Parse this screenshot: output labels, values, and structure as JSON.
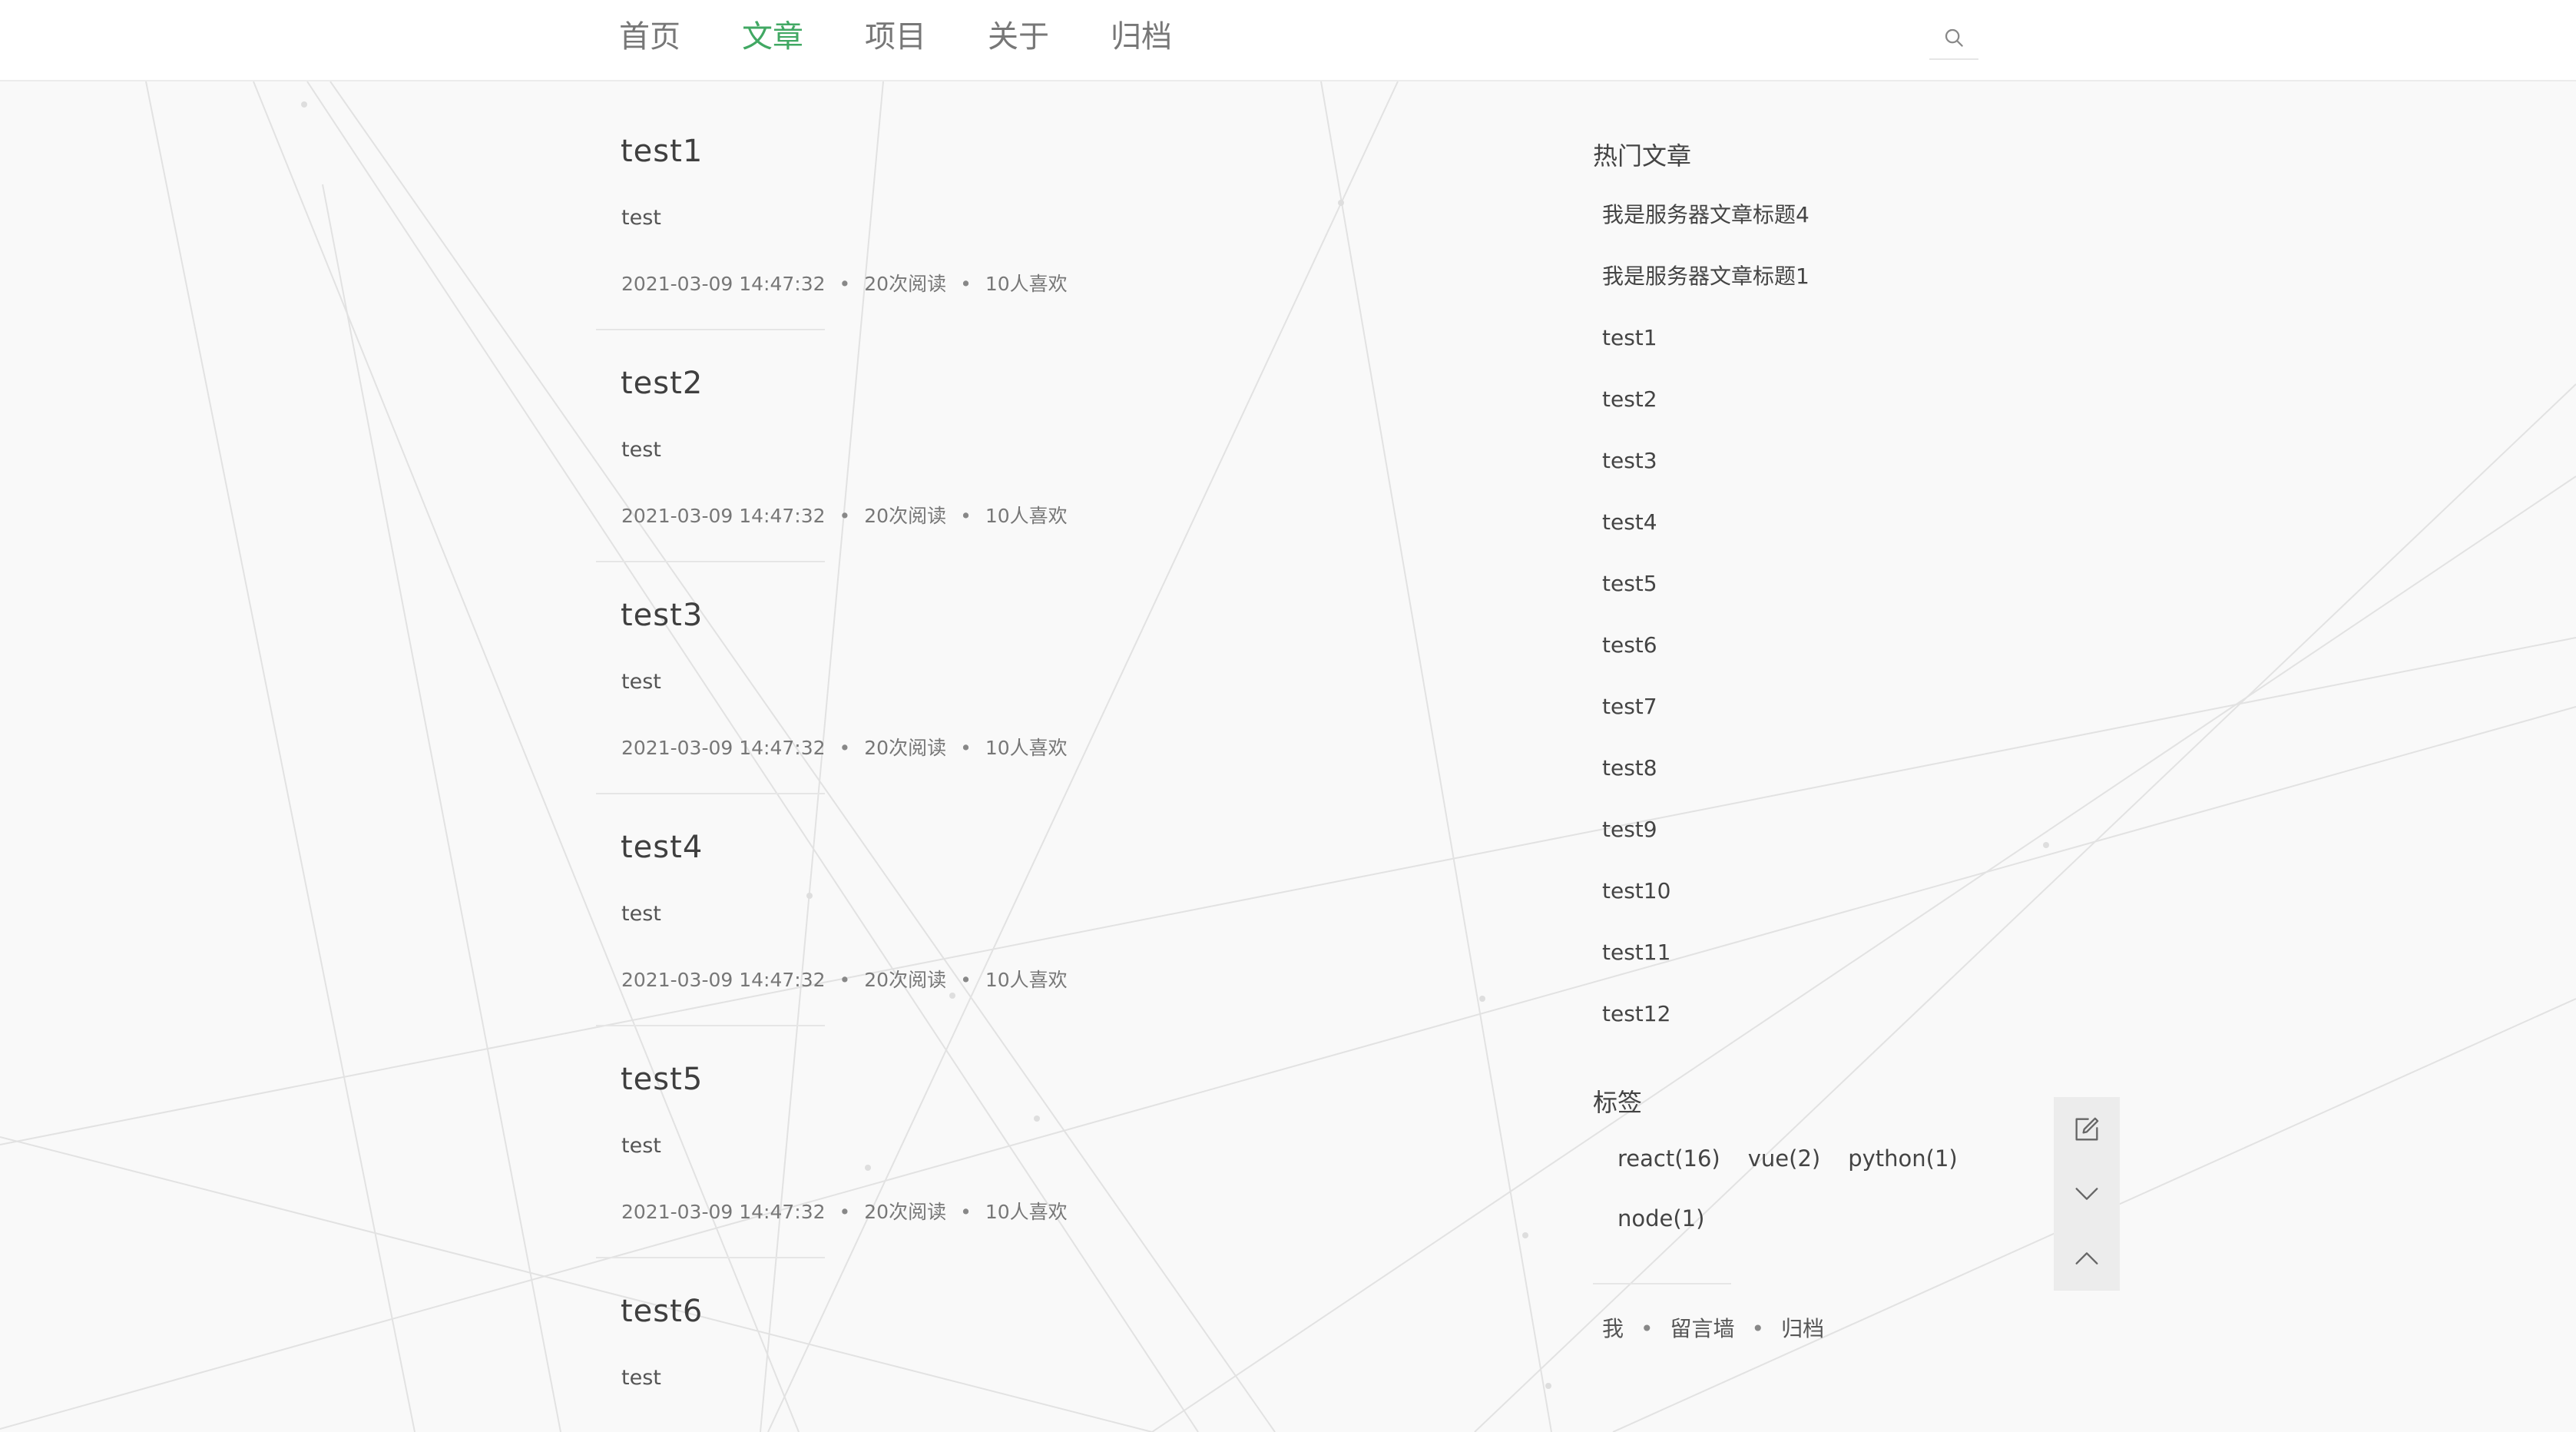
{
  "nav": {
    "items": [
      {
        "label": "首页"
      },
      {
        "label": "文章"
      },
      {
        "label": "项目"
      },
      {
        "label": "关于"
      },
      {
        "label": "归档"
      }
    ],
    "active_index": 1,
    "active_color": "#41a863",
    "search_icon": "search-icon"
  },
  "articles": [
    {
      "title": "test1",
      "summary": "test",
      "datetime": "2021-03-09 14:47:32",
      "reads": "20次阅读",
      "likes": "10人喜欢"
    },
    {
      "title": "test2",
      "summary": "test",
      "datetime": "2021-03-09 14:47:32",
      "reads": "20次阅读",
      "likes": "10人喜欢"
    },
    {
      "title": "test3",
      "summary": "test",
      "datetime": "2021-03-09 14:47:32",
      "reads": "20次阅读",
      "likes": "10人喜欢"
    },
    {
      "title": "test4",
      "summary": "test",
      "datetime": "2021-03-09 14:47:32",
      "reads": "20次阅读",
      "likes": "10人喜欢"
    },
    {
      "title": "test5",
      "summary": "test",
      "datetime": "2021-03-09 14:47:32",
      "reads": "20次阅读",
      "likes": "10人喜欢"
    },
    {
      "title": "test6",
      "summary": "test",
      "datetime": "",
      "reads": "",
      "likes": ""
    }
  ],
  "meta_separator": "•",
  "sidebar": {
    "hot_title": "热门文章",
    "hot_items": [
      "我是服务器文章标题4",
      "我是服务器文章标题1",
      "test1",
      "test2",
      "test3",
      "test4",
      "test5",
      "test6",
      "test7",
      "test8",
      "test9",
      "test10",
      "test11",
      "test12"
    ],
    "tags_title": "标签",
    "tags": [
      "react(16)",
      "vue(2)",
      "python(1)",
      "node(1)"
    ],
    "footer_links": [
      "我",
      "留言墙",
      "归档"
    ],
    "footer_separator": "•"
  },
  "float_tools": [
    "edit-icon",
    "chevron-down-icon",
    "chevron-up-icon"
  ]
}
